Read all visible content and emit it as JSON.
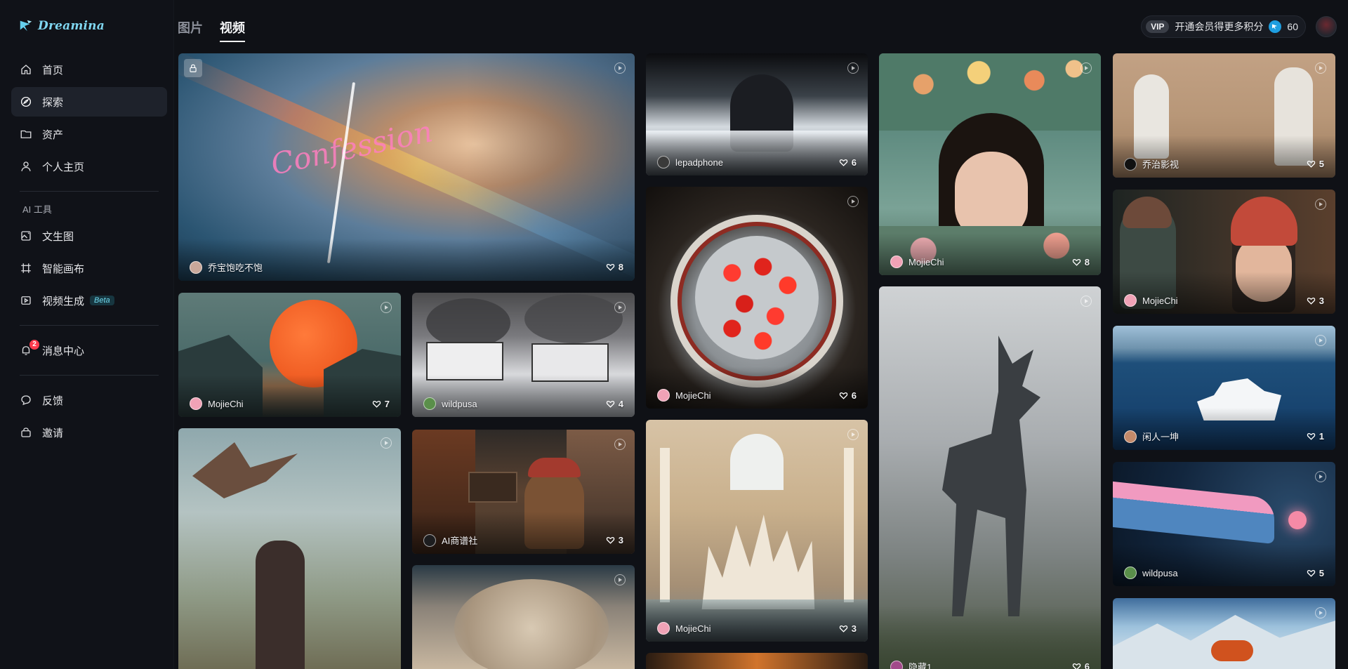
{
  "app": {
    "logo_text": "Dreamina"
  },
  "sidebar": {
    "nav": [
      {
        "label": "首页",
        "icon": "home-icon",
        "active": false
      },
      {
        "label": "探索",
        "icon": "compass-icon",
        "active": true
      },
      {
        "label": "资产",
        "icon": "folder-icon",
        "active": false
      },
      {
        "label": "个人主页",
        "icon": "user-icon",
        "active": false
      }
    ],
    "tools_title": "AI 工具",
    "tools": [
      {
        "label": "文生图",
        "icon": "image-gen-icon"
      },
      {
        "label": "智能画布",
        "icon": "canvas-icon"
      },
      {
        "label": "视频生成",
        "icon": "video-gen-icon",
        "tag": "Beta"
      }
    ],
    "messages": {
      "label": "消息中心",
      "badge": "2"
    },
    "bottom": [
      {
        "label": "反馈",
        "icon": "feedback-icon"
      },
      {
        "label": "邀请",
        "icon": "invite-icon"
      }
    ]
  },
  "tabs": [
    {
      "label": "图片",
      "active": false
    },
    {
      "label": "视频",
      "active": true
    }
  ],
  "topbar": {
    "vip_tag": "VIP",
    "vip_text": "开通会员得更多积分",
    "credits": "60"
  },
  "colors": {
    "accent": "#6fd9ee",
    "background": "#0f1116",
    "sidebar_active": "#1e222b",
    "badge": "#ff3b4e"
  },
  "cards": [
    {
      "id": "c1",
      "author": "乔宝饱吃不饱",
      "likes": "8",
      "locked": true,
      "overlay_text": "Confession"
    },
    {
      "id": "c2",
      "author": "lepadphone",
      "likes": "6"
    },
    {
      "id": "c3",
      "author": "MojieChi",
      "likes": "8"
    },
    {
      "id": "c4",
      "author": "乔治影视",
      "likes": "5"
    },
    {
      "id": "c5",
      "author": "MojieChi",
      "likes": "3"
    },
    {
      "id": "c6",
      "author": "MojieChi",
      "likes": "7"
    },
    {
      "id": "c7",
      "author": "wildpusa",
      "likes": "4"
    },
    {
      "id": "c8",
      "author": "MojieChi",
      "likes": "6"
    },
    {
      "id": "c9",
      "author": "闲人一坤",
      "likes": "1"
    },
    {
      "id": "c10",
      "author": "AI商谱社",
      "likes": "3"
    },
    {
      "id": "c11",
      "author": "MojieChi",
      "likes": "3"
    },
    {
      "id": "c12",
      "author": "wildpusa",
      "likes": "5"
    },
    {
      "id": "c13",
      "author": "",
      "likes": ""
    },
    {
      "id": "c14",
      "author": "",
      "likes": ""
    },
    {
      "id": "c15",
      "author": "隐藏1",
      "likes": "6"
    },
    {
      "id": "c16",
      "author": "",
      "likes": ""
    },
    {
      "id": "c17",
      "author": "",
      "likes": ""
    }
  ]
}
